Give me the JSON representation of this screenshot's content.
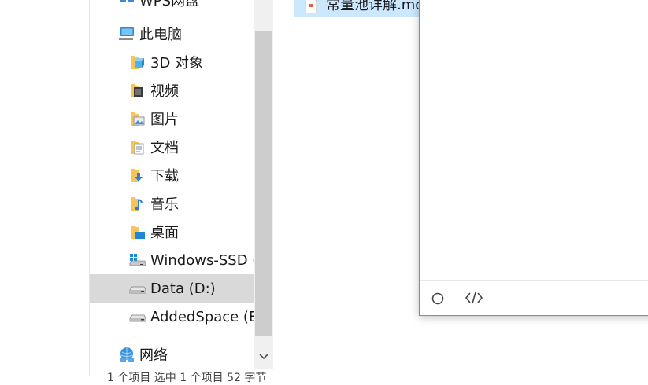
{
  "nav": {
    "top_cut_label": "WPS网盘",
    "this_pc": "此电脑",
    "items": [
      {
        "label": "3D 对象",
        "icon": "folder-3d-objects-icon"
      },
      {
        "label": "视频",
        "icon": "folder-videos-icon"
      },
      {
        "label": "图片",
        "icon": "folder-pictures-icon"
      },
      {
        "label": "文档",
        "icon": "folder-documents-icon"
      },
      {
        "label": "下载",
        "icon": "folder-downloads-icon"
      },
      {
        "label": "音乐",
        "icon": "folder-music-icon"
      },
      {
        "label": "桌面",
        "icon": "folder-desktop-icon"
      }
    ],
    "drives": [
      {
        "label": "Windows-SSD (",
        "icon": "windows-drive-icon"
      },
      {
        "label": "Data (D:)",
        "icon": "drive-icon"
      },
      {
        "label": "AddedSpace (E",
        "icon": "drive-icon"
      }
    ],
    "network": "网络"
  },
  "file_list": {
    "selected_file": "常量池详解.md"
  },
  "status_bar": {
    "text": "1 个项目   选中 1 个项目  52 字节"
  },
  "editor": {
    "footer_icons": [
      "circle-icon",
      "code-icon"
    ]
  }
}
